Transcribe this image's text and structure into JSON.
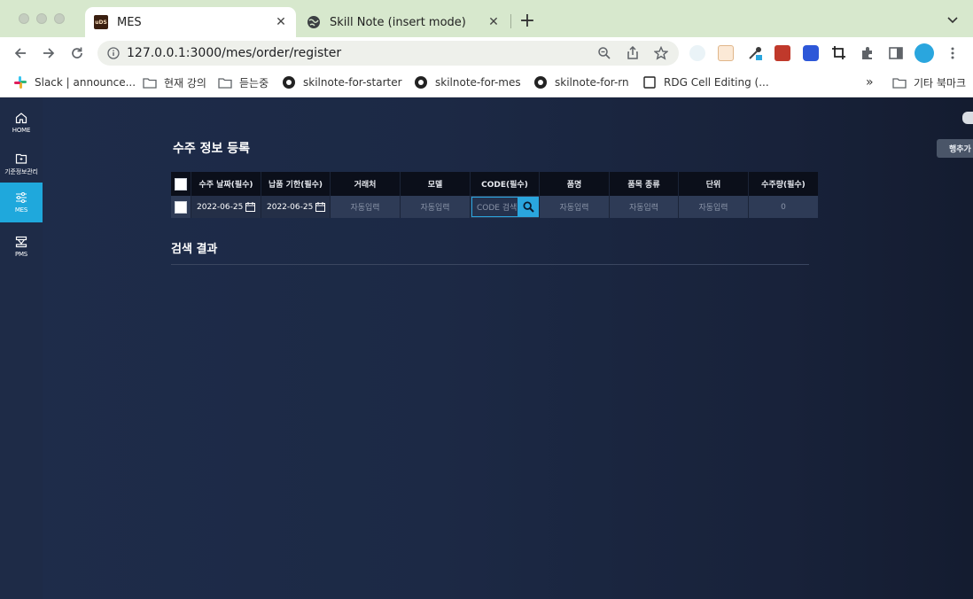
{
  "browser": {
    "tabs": [
      {
        "title": "MES",
        "active": true
      },
      {
        "title": "Skill Note (insert mode)",
        "active": false
      }
    ],
    "url_host": "127.0.0.1",
    "url_rest": ":3000/mes/order/register",
    "bookmarks": [
      {
        "label": "Slack | announce...",
        "icon": "slack-icon"
      },
      {
        "label": "현재 강의",
        "icon": "folder-icon"
      },
      {
        "label": "듣는중",
        "icon": "folder-icon"
      },
      {
        "label": "skilnote-for-starter",
        "icon": "github-icon"
      },
      {
        "label": "skilnote-for-mes",
        "icon": "github-icon"
      },
      {
        "label": "skilnote-for-rn",
        "icon": "github-icon"
      },
      {
        "label": "RDG Cell Editing (...",
        "icon": "page-icon"
      }
    ],
    "bookmarks_more": "»",
    "other_bookmarks": "기타 북마크"
  },
  "sidebar": {
    "items": [
      {
        "label": "HOME",
        "icon": "home-icon",
        "active": false
      },
      {
        "label": "기준정보관리",
        "icon": "folder-icon",
        "active": false
      },
      {
        "label": "MES",
        "icon": "sliders-icon",
        "active": true
      },
      {
        "label": "PMS",
        "icon": "machine-icon",
        "active": false
      }
    ]
  },
  "main": {
    "title": "수주 정보 등록",
    "table": {
      "headers": [
        "수주 날짜(필수)",
        "납품 기한(필수)",
        "거래처",
        "모델",
        "CODE(필수)",
        "품명",
        "품목 종류",
        "단위",
        "수주량(필수)"
      ],
      "row": {
        "order_date": "2022-06-25",
        "due_date": "2022-06-25",
        "client": "자동입력",
        "model": "자동입력",
        "code_placeholder": "CODE 검색",
        "item_name": "자동입력",
        "item_type": "자동입력",
        "unit": "자동입력",
        "quantity": "0"
      }
    },
    "result_title": "검색 결과",
    "right_button": "행추가"
  },
  "colors": {
    "accent": "#1fa8dc",
    "background": "#1c2945",
    "header_bg": "#0b0f1a"
  }
}
